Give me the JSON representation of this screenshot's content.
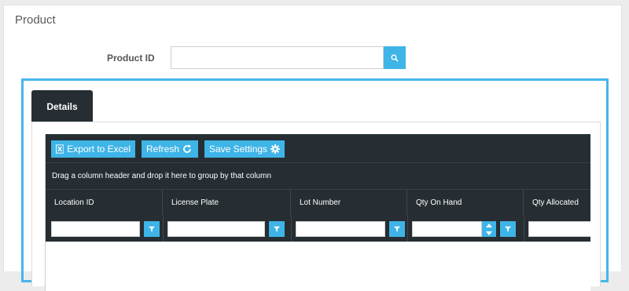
{
  "page": {
    "title": "Product"
  },
  "product_id": {
    "label": "Product ID",
    "value": "",
    "placeholder": ""
  },
  "tabs": [
    {
      "label": "Details",
      "active": true
    }
  ],
  "toolbar": {
    "export_label": "Export to Excel",
    "refresh_label": "Refresh",
    "save_settings_label": "Save Settings"
  },
  "grid": {
    "group_hint": "Drag a column header and drop it here to group by that column",
    "columns": [
      "Location ID",
      "License Plate",
      "Lot Number",
      "Qty On Hand",
      "Qty Allocated"
    ],
    "filters": [
      "",
      "",
      "",
      "",
      ""
    ]
  },
  "colors": {
    "accent": "#3fb4e6",
    "grid_header": "#262e33",
    "tab_border": "#45b6ea"
  }
}
